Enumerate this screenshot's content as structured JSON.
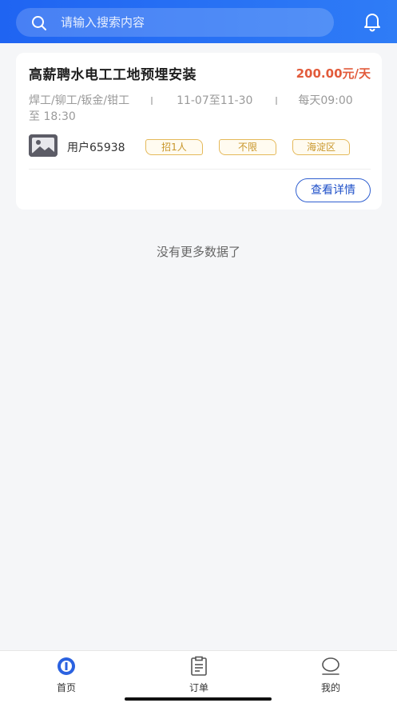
{
  "search": {
    "placeholder": "请输入搜索内容"
  },
  "job": {
    "title": "高薪聘水电工工地预埋安装",
    "salary": "200.00元/天",
    "skills": "焊工/铆工/钣金/钳工",
    "date_range": "11-07至11-30",
    "hours_part1": "每天09:00",
    "hours_part2": "至 18:30",
    "user": "用户65938",
    "tags": [
      "招1人",
      "不限",
      "海淀区"
    ],
    "detail_button": "查看详情"
  },
  "list_end_text": "没有更多数据了",
  "tabbar": {
    "items": [
      {
        "label": "首页",
        "icon": "home-icon"
      },
      {
        "label": "订单",
        "icon": "clipboard-icon"
      },
      {
        "label": "我的",
        "icon": "user-icon"
      }
    ]
  },
  "colors": {
    "header": "#1f64f2",
    "salary": "#e25b3b",
    "tag": "#c8962a",
    "button": "#1e4fc8"
  }
}
